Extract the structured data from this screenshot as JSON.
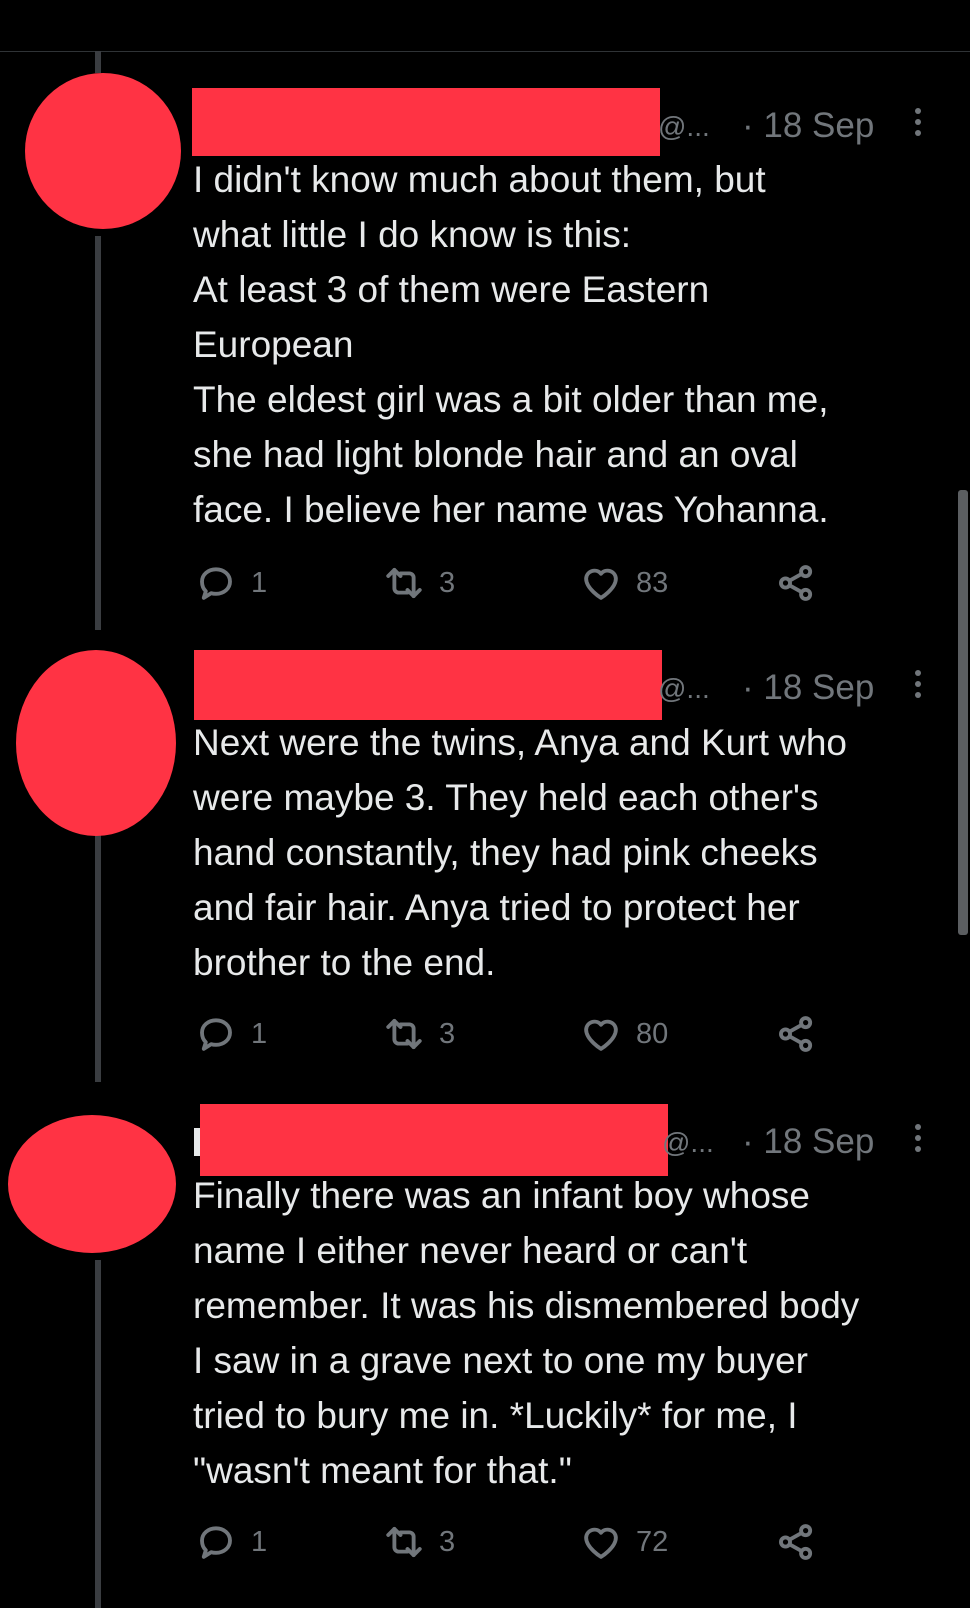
{
  "tweets": [
    {
      "handle": "@...",
      "date": "· 18 Sep",
      "text": "I didn't know much about them, but\nwhat little I do know is this:\nAt least 3 of them were Eastern\nEuropean\nThe eldest girl was a bit older than me,\nshe had light blonde hair and an oval\nface. I believe her name was Yohanna.",
      "replies": "1",
      "retweets": "3",
      "likes": "83"
    },
    {
      "handle": "@...",
      "date": "· 18 Sep",
      "text": "Next were the twins, Anya and Kurt who\nwere maybe 3. They held each other's\nhand constantly, they had pink cheeks\nand fair hair. Anya tried to protect her\nbrother to the end.",
      "replies": "1",
      "retweets": "3",
      "likes": "80"
    },
    {
      "handle": "@...",
      "date": "· 18 Sep",
      "text": "Finally there was an infant boy whose\nname I either never heard or can't\nremember. It was his dismembered body\nI saw in a grave next to one my buyer\ntried to bury me in. *Luckily* for me, I\n\"wasn't meant for that.\"",
      "replies": "1",
      "retweets": "3",
      "likes": "72"
    }
  ],
  "icons": {
    "reply": "reply-icon",
    "retweet": "retweet-icon",
    "like": "heart-icon",
    "share": "share-icon",
    "more": "more-options-icon"
  },
  "colors": {
    "background": "#000000",
    "text": "#e7e9ea",
    "muted": "#71767b",
    "redaction": "#ff3344",
    "thread_line": "#3a3d41"
  }
}
